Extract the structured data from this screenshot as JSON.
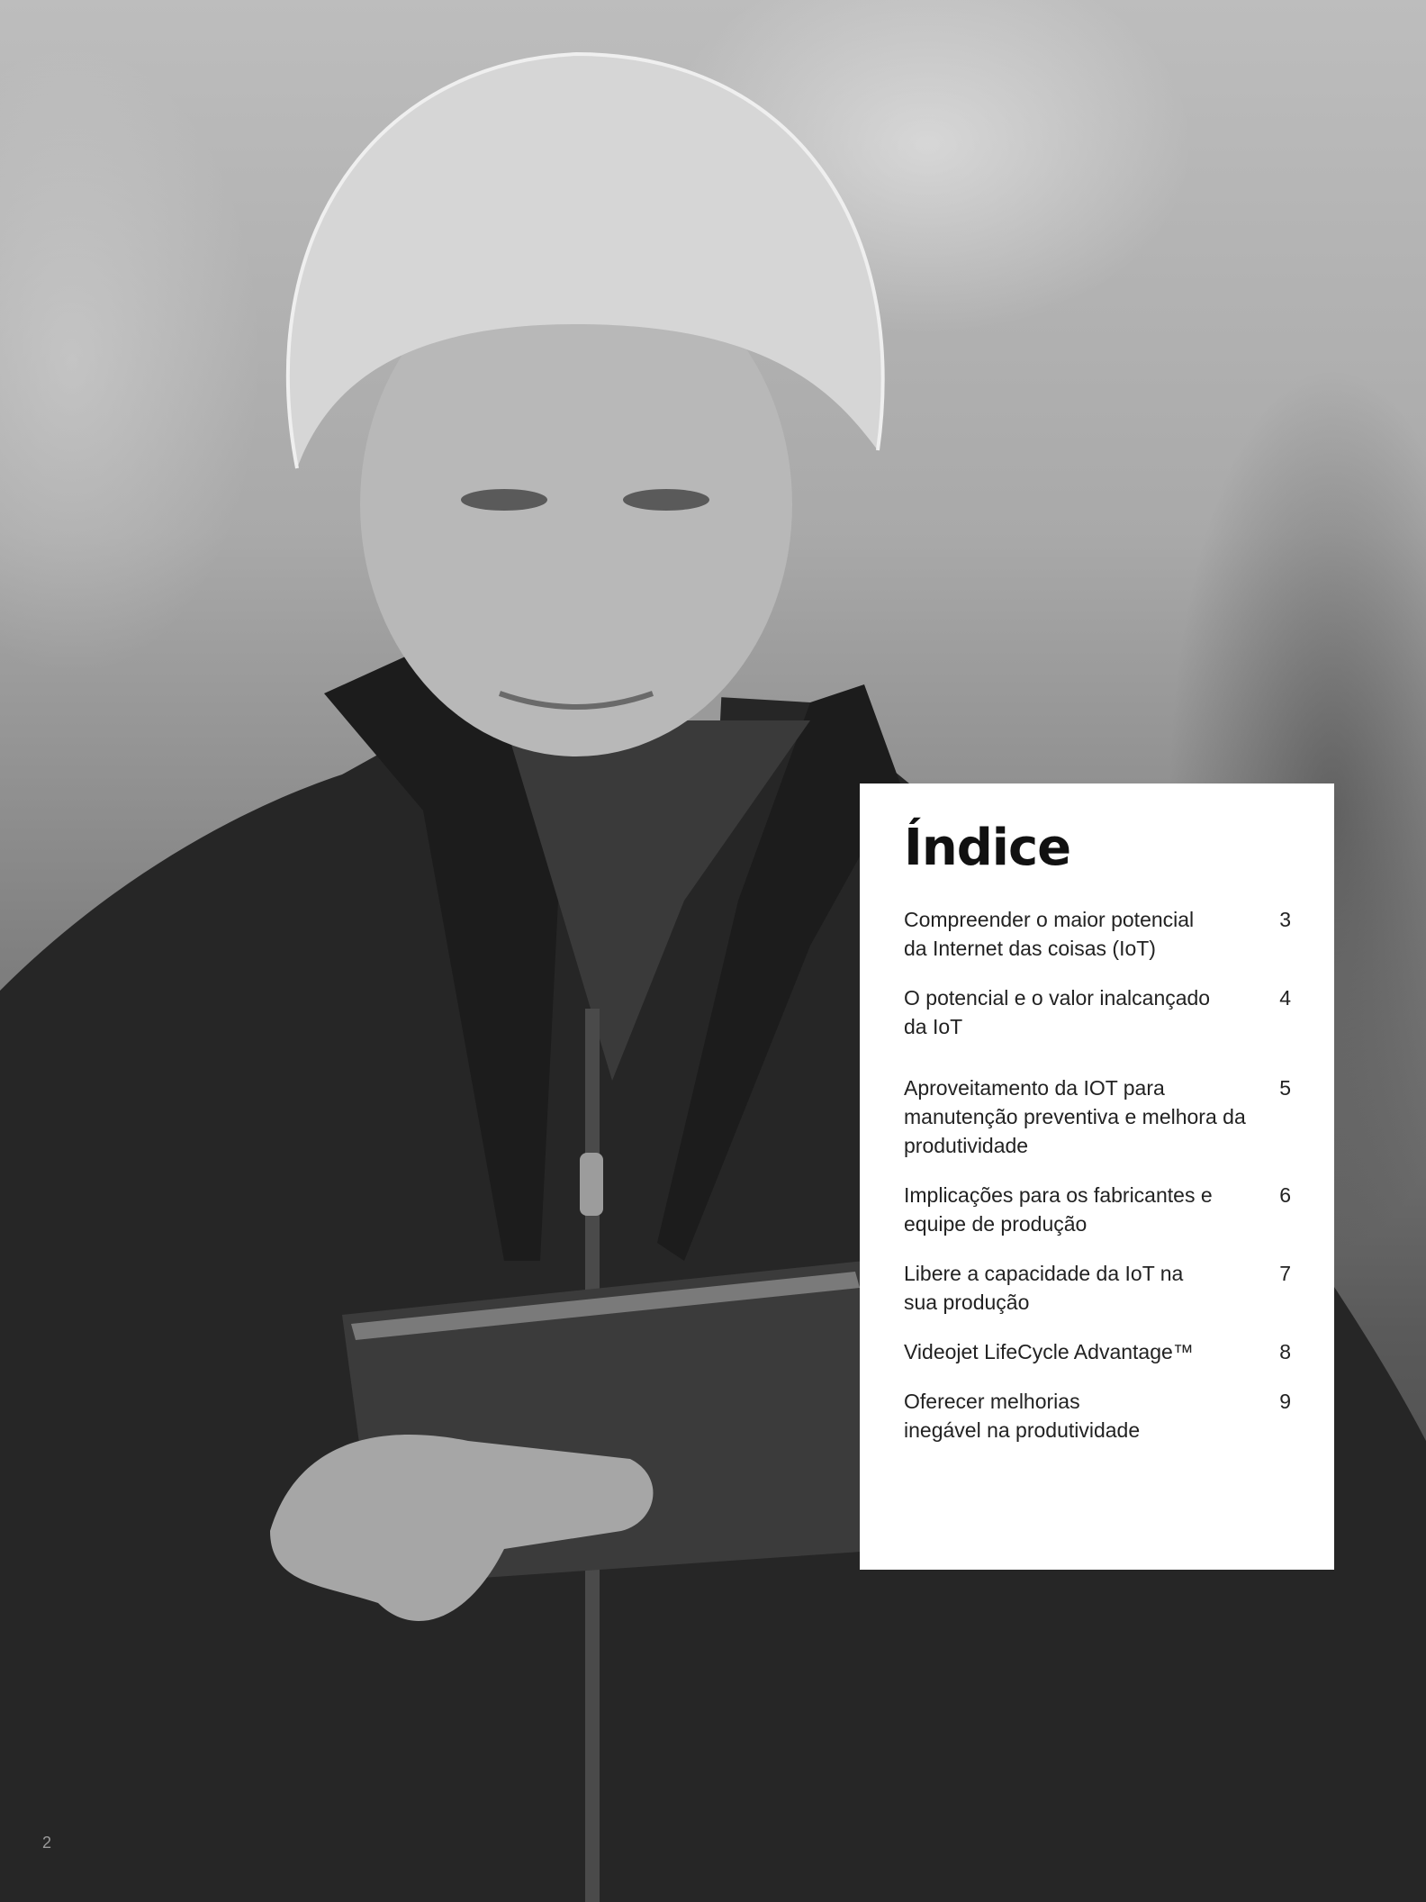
{
  "photo": {
    "description_icon": "woman-with-hairnet-holding-tablet-photo"
  },
  "toc": {
    "title": "Índice",
    "items": [
      {
        "text": "Compreender o maior potencial\nda Internet das coisas (IoT)",
        "page": "3"
      },
      {
        "text": "O potencial e o valor inalcançado\nda IoT",
        "page": "4"
      },
      {
        "text": "Aproveitamento da IOT para\nmanutenção preventiva e melhora da\nprodutividade",
        "page": "5"
      },
      {
        "text": "Implicações para os fabricantes e\nequipe de produção",
        "page": "6"
      },
      {
        "text": "Libere a capacidade da IoT na\nsua produção",
        "page": "7"
      },
      {
        "text": "Videojet LifeCycle Advantage™",
        "page": "8"
      },
      {
        "text": "Oferecer melhorias\ninegável na produtividade",
        "page": "9"
      }
    ]
  },
  "footer": {
    "page_number": "2"
  },
  "colors": {
    "panel_background": "#ffffff",
    "title_text": "#111111",
    "body_text": "#222222"
  }
}
